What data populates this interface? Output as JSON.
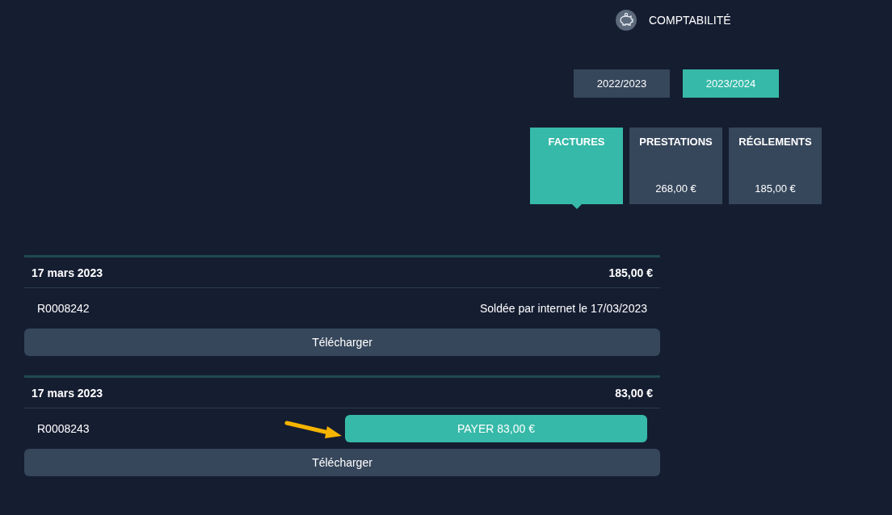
{
  "header": {
    "title": "COMPTABILITÉ"
  },
  "years": [
    {
      "label": "2022/2023",
      "selected": false
    },
    {
      "label": "2023/2024",
      "selected": true
    }
  ],
  "tabs": [
    {
      "label": "FACTURES",
      "selected": true
    },
    {
      "label": "PRESTATIONS",
      "amount": "268,00 €",
      "selected": false
    },
    {
      "label": "RÉGLEMENTS",
      "amount": "185,00 €",
      "selected": false
    }
  ],
  "invoices": [
    {
      "date": "17 mars 2023",
      "total": "185,00 €",
      "number": "R0008242",
      "kind": "paid",
      "status": "Soldée par internet le 17/03/2023",
      "download": "Télécharger",
      "pointer_arrow": false
    },
    {
      "date": "17 mars 2023",
      "total": "83,00 €",
      "number": "R0008243",
      "kind": "unpaid",
      "pay_button": "PAYER 83,00 €",
      "download": "Télécharger",
      "pointer_arrow": true
    }
  ]
}
